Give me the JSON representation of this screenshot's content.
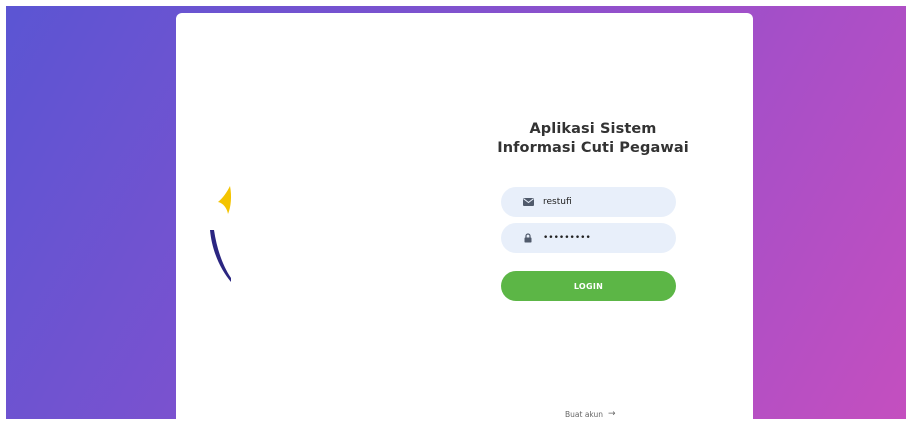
{
  "app": {
    "title": "Aplikasi Sistem Informasi Cuti Pegawai"
  },
  "form": {
    "username_value": "restufi",
    "password_value": "restufi12",
    "login_label": "LOGIN"
  },
  "footer": {
    "signup_label": "Buat akun",
    "signup_arrow": "→"
  },
  "icons": {
    "username": "envelope-icon",
    "password": "lock-icon"
  },
  "colors": {
    "gradient_start": "#5b55d3",
    "gradient_end": "#c44fbf",
    "login_button": "#5cb646",
    "field_background": "#e8effa",
    "logo_yellow": "#f4c400",
    "logo_navy": "#2b2681"
  }
}
